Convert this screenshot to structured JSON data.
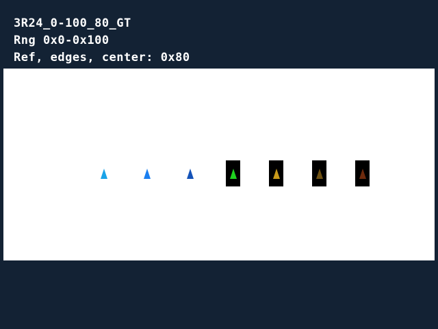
{
  "header": {
    "line1": "3R24_0-100_80_GT",
    "line2": "Rng 0x0-0x100",
    "line3": "Ref, edges, center: 0x80"
  },
  "markers": [
    {
      "color": "#1aa3e8",
      "boxed": false
    },
    {
      "color": "#1a7ff0",
      "boxed": false
    },
    {
      "color": "#1553b8",
      "boxed": false
    },
    {
      "color": "#1fd21f",
      "boxed": true
    },
    {
      "color": "#c99a1a",
      "boxed": true
    },
    {
      "color": "#6e5012",
      "boxed": true
    },
    {
      "color": "#6e2a0d",
      "boxed": true
    }
  ]
}
